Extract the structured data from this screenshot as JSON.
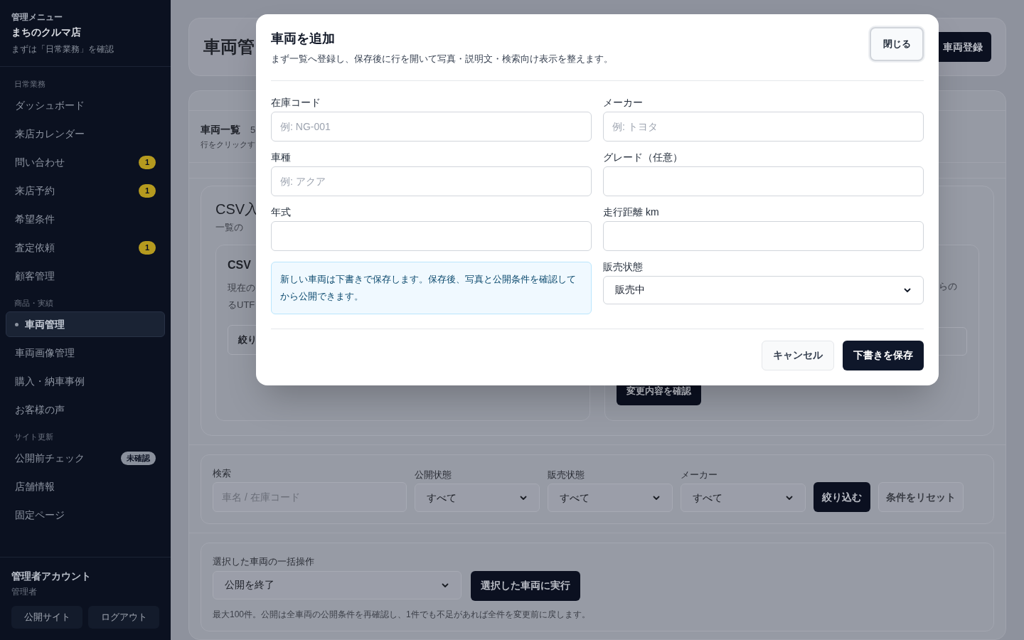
{
  "sidebar": {
    "eyebrow": "管理メニュー",
    "shop_name": "まちのクルマ店",
    "hint": "まずは「日常業務」を確認",
    "sections": [
      {
        "heading": "日常業務",
        "items": [
          {
            "label": "ダッシュボード",
            "selected": false
          },
          {
            "label": "来店カレンダー",
            "selected": false
          },
          {
            "label": "問い合わせ",
            "selected": false,
            "badge": {
              "kind": "count",
              "text": "1"
            }
          },
          {
            "label": "来店予約",
            "selected": false,
            "badge": {
              "kind": "count",
              "text": "1"
            }
          },
          {
            "label": "希望条件",
            "selected": false
          },
          {
            "label": "査定依頼",
            "selected": false,
            "badge": {
              "kind": "count",
              "text": "1"
            }
          },
          {
            "label": "顧客管理",
            "selected": false
          }
        ]
      },
      {
        "heading": "商品・実績",
        "items": [
          {
            "label": "車両管理",
            "selected": true
          },
          {
            "label": "車両画像管理",
            "selected": false
          },
          {
            "label": "購入・納車事例",
            "selected": false
          },
          {
            "label": "お客様の声",
            "selected": false
          }
        ]
      },
      {
        "heading": "サイト更新",
        "items": [
          {
            "label": "公開前チェック",
            "selected": false,
            "badge": {
              "kind": "status",
              "text": "未確認"
            }
          },
          {
            "label": "店舗情報",
            "selected": false
          },
          {
            "label": "固定ページ",
            "selected": false
          }
        ]
      }
    ],
    "account": {
      "name": "管理者アカウント",
      "role": "管理者",
      "buttons": [
        "公開サイト",
        "ログアウト"
      ]
    }
  },
  "page": {
    "title": "車両管",
    "new_button": "車両登録",
    "list": {
      "title": "車両一覧",
      "count": "5",
      "hint": "行をクリックす"
    },
    "csv": {
      "title": "CSV入",
      "description": "一覧の",
      "export": {
        "title": "CSV",
        "lines": [
          "現在の",
          "るUTF"
        ],
        "button": "絞り"
      },
      "import": {
        "line": "らの",
        "button": "変更内容を確認"
      }
    },
    "filters": {
      "search_label": "検索",
      "search_placeholder": "車名 / 在庫コード",
      "selects": [
        {
          "label": "公開状態",
          "value": "すべて"
        },
        {
          "label": "販売状態",
          "value": "すべて"
        },
        {
          "label": "メーカー",
          "value": "すべて"
        }
      ],
      "apply_button": "絞り込む",
      "reset_button": "条件をリセット"
    },
    "bulk": {
      "label": "選択した車両の一括操作",
      "value": "公開を終了",
      "button": "選択した車両に実行",
      "note": "最大100件。公開は全車両の公開条件を再確認し、1件でも不足があれば全件を変更前に戻します。"
    }
  },
  "dialog": {
    "title": "車両を追加",
    "subtitle": "まず一覧へ登録し、保存後に行を開いて写真・説明文・検索向け表示を整えます。",
    "close_button": "閉じる",
    "fields": [
      {
        "kind": "input",
        "label": "在庫コード",
        "placeholder": "例: NG-001"
      },
      {
        "kind": "input",
        "label": "メーカー",
        "placeholder": "例: トヨタ"
      },
      {
        "kind": "input",
        "label": "車種",
        "placeholder": "例: アクア"
      },
      {
        "kind": "input",
        "label": "グレード（任意）"
      },
      {
        "kind": "input",
        "label": "年式"
      },
      {
        "kind": "input",
        "label": "走行距離 km"
      },
      {
        "kind": "note",
        "text": "新しい車両は下書きで保存します。保存後、写真と公開条件を確認してから公開できます。"
      },
      {
        "kind": "select",
        "label": "販売状態",
        "value": "販売中"
      }
    ],
    "cancel_button": "キャンセル",
    "save_button": "下書きを保存"
  }
}
